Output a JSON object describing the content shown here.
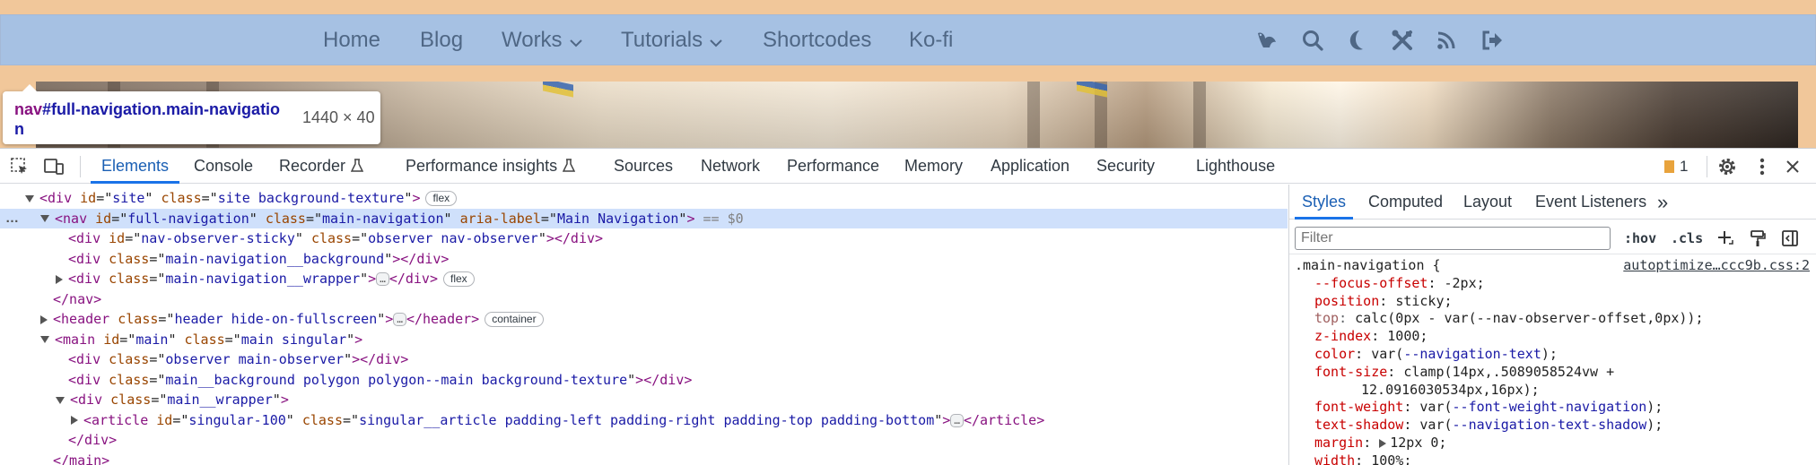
{
  "site": {
    "nav_items": [
      {
        "label": "Home"
      },
      {
        "label": "Blog"
      },
      {
        "label": "Works"
      },
      {
        "label": "Tutorials"
      },
      {
        "label": "Shortcodes"
      },
      {
        "label": "Ko-fi"
      }
    ],
    "nav_icons": [
      "bird-icon",
      "search-icon",
      "moon-icon",
      "tools-icon",
      "rss-icon",
      "logout-icon"
    ],
    "colors": {
      "nav_bg": "#a6c1e3",
      "nav_text": "#4f6785",
      "page_bg": "#f1c79a"
    }
  },
  "tooltip": {
    "tag": "nav",
    "selector": "#full-navigation.main-navigation",
    "size": "1440 × 40"
  },
  "devtools": {
    "tabs": [
      {
        "label": "Elements",
        "active": true
      },
      {
        "label": "Console"
      },
      {
        "label": "Recorder",
        "experimental": true
      },
      {
        "label": "Performance insights",
        "experimental": true
      },
      {
        "label": "Sources"
      },
      {
        "label": "Network"
      },
      {
        "label": "Performance"
      },
      {
        "label": "Memory"
      },
      {
        "label": "Application"
      },
      {
        "label": "Security"
      },
      {
        "label": "Lighthouse"
      }
    ],
    "issues_count": "1",
    "toolbar_icons": [
      "inspect-element-icon",
      "device-toolbar-icon",
      "settings-icon",
      "more-vert-icon",
      "close-icon"
    ]
  },
  "dom": {
    "lines": [
      {
        "tag": "div",
        "attrs": [
          [
            "id",
            "site"
          ],
          [
            "class",
            "site background-texture"
          ]
        ],
        "pill": "flex",
        "toggle": "open",
        "indent": 0
      },
      {
        "tag": "nav",
        "attrs": [
          [
            "id",
            "full-navigation"
          ],
          [
            "class",
            "main-navigation"
          ],
          [
            "aria-label",
            "Main Navigation"
          ]
        ],
        "suffix": "== $0",
        "toggle": "open",
        "indent": 1,
        "selected": true
      },
      {
        "tag": "div",
        "attrs": [
          [
            "id",
            "nav-observer-sticky"
          ],
          [
            "class",
            "observer nav-observer"
          ]
        ],
        "close": "</div>",
        "indent": 2
      },
      {
        "tag": "div",
        "attrs": [
          [
            "class",
            "main-navigation__background"
          ]
        ],
        "close": "</div>",
        "indent": 2
      },
      {
        "tag": "div",
        "attrs": [
          [
            "class",
            "main-navigation__wrapper"
          ]
        ],
        "collapsed": true,
        "close": "</div>",
        "pill": "flex",
        "toggle": "closed",
        "indent": 2
      },
      {
        "text": "</nav>",
        "indent": 1
      },
      {
        "tag": "header",
        "attrs": [
          [
            "class",
            "header hide-on-fullscreen"
          ]
        ],
        "collapsed": true,
        "close": "</header>",
        "pill": "container",
        "toggle": "closed",
        "indent": 1
      },
      {
        "tag": "main",
        "attrs": [
          [
            "id",
            "main"
          ],
          [
            "class",
            "main singular"
          ]
        ],
        "toggle": "open",
        "indent": 1
      },
      {
        "tag": "div",
        "attrs": [
          [
            "class",
            "observer main-observer"
          ]
        ],
        "close": "</div>",
        "indent": 2
      },
      {
        "tag": "div",
        "attrs": [
          [
            "class",
            "main__background polygon polygon--main background-texture"
          ]
        ],
        "close": "</div>",
        "indent": 2
      },
      {
        "tag": "div",
        "attrs": [
          [
            "class",
            "main__wrapper"
          ]
        ],
        "toggle": "open",
        "indent": 2
      },
      {
        "tag": "article",
        "attrs": [
          [
            "id",
            "singular-100"
          ],
          [
            "class",
            "singular__article padding-left padding-right padding-top padding-bottom"
          ]
        ],
        "collapsed": true,
        "close": "</article>",
        "toggle": "closed",
        "indent": 3
      },
      {
        "text": "</div>",
        "indent": 2
      },
      {
        "text": "</main>",
        "indent": 1
      }
    ]
  },
  "styles_pane": {
    "tabs": [
      {
        "label": "Styles",
        "active": true
      },
      {
        "label": "Computed"
      },
      {
        "label": "Layout"
      },
      {
        "label": "Event Listeners"
      }
    ],
    "more_tabs": "»",
    "filter_placeholder": "Filter",
    "hov_label": ":hov",
    "cls_label": ".cls",
    "selector": ".main-navigation {",
    "source": "autoptimize…ccc9b.css:2",
    "declarations": [
      {
        "prop": "--focus-offset",
        "value": "-2px;"
      },
      {
        "prop": "position",
        "value": "sticky;"
      },
      {
        "prop": "top",
        "value": "calc(0px - var(--nav-observer-offset,0px));",
        "strike": true
      },
      {
        "prop": "z-index",
        "value": "1000;"
      },
      {
        "prop": "color",
        "value": "var(--navigation-text);"
      },
      {
        "prop": "font-size",
        "value": "clamp(14px,.5089058524vw +",
        "cont": "12.0916030534px,16px);"
      },
      {
        "prop": "font-weight",
        "value": "var(--font-weight-navigation);"
      },
      {
        "prop": "text-shadow",
        "value": "var(--navigation-text-shadow);"
      },
      {
        "prop": "margin",
        "value": "12px 0;",
        "expander": true
      },
      {
        "prop": "width",
        "value": "100%;"
      }
    ]
  }
}
